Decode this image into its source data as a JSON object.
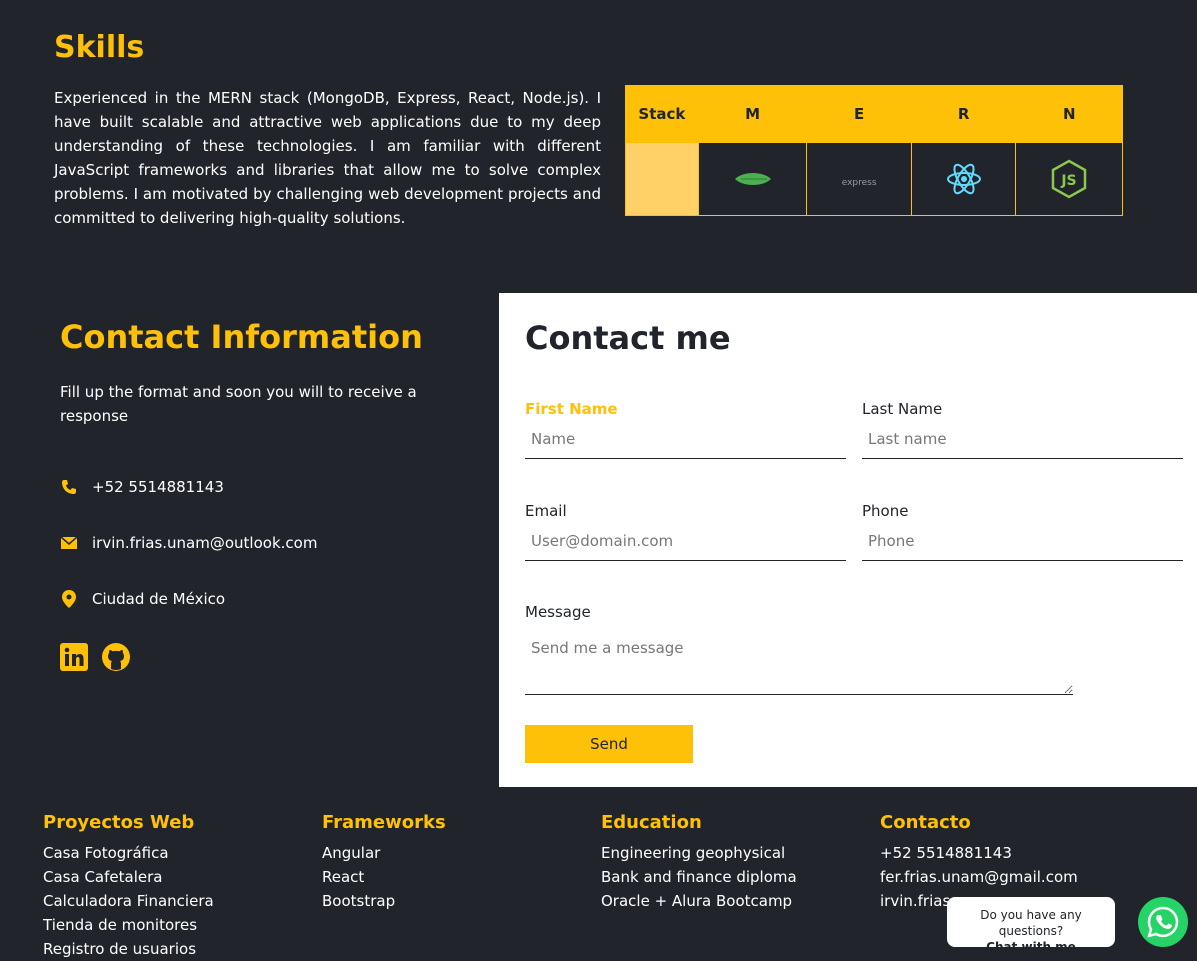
{
  "skills": {
    "title": "Skills",
    "description": "Experienced in the MERN stack (MongoDB, Express, React, Node.js). I have built scalable and attractive web applications due to my deep understanding of these technologies. I am familiar with different JavaScript frameworks and libraries that allow me to solve complex problems. I am motivated by challenging web development projects and committed to delivering high-quality solutions.",
    "table_headers": [
      "Stack",
      "M",
      "E",
      "R",
      "N"
    ],
    "table_icons": [
      "mongodb-icon",
      "express-icon",
      "react-icon",
      "nodejs-icon"
    ],
    "express_text": "express"
  },
  "contact_info": {
    "title": "Contact Information",
    "description": "Fill up the format and soon you will to receive a response",
    "phone": "+52 5514881143",
    "email": "irvin.frias.unam@outlook.com",
    "location": "Ciudad de México",
    "social": [
      "linkedin-icon",
      "github-icon"
    ]
  },
  "form": {
    "title": "Contact me",
    "first_name_label": "First Name",
    "first_name_placeholder": "Name",
    "last_name_label": "Last Name",
    "last_name_placeholder": "Last name",
    "email_label": "Email",
    "email_placeholder": "User@domain.com",
    "phone_label": "Phone",
    "phone_placeholder": "Phone",
    "message_label": "Message",
    "message_placeholder": "Send me a message",
    "send_label": "Send"
  },
  "footer": {
    "projects": {
      "title": "Proyectos Web",
      "items": [
        "Casa Fotográfica",
        "Casa Cafetalera",
        "Calculadora Financiera",
        "Tienda de monitores",
        "Registro de usuarios"
      ]
    },
    "frameworks": {
      "title": "Frameworks",
      "items": [
        "Angular",
        "React",
        "Bootstrap"
      ]
    },
    "education": {
      "title": "Education",
      "items": [
        "Engineering geophysical",
        "Bank and finance diploma",
        "Oracle + Alura Bootcamp"
      ]
    },
    "contact": {
      "title": "Contacto",
      "items": [
        "+52 5514881143",
        "fer.frias.unam@gmail.com",
        "irvin.frias."
      ]
    }
  },
  "chat": {
    "question": "Do you have any questions?",
    "cta": "Chat with me"
  },
  "colors": {
    "background": "#21242b",
    "accent": "#ffc107",
    "whatsapp": "#25d366"
  }
}
